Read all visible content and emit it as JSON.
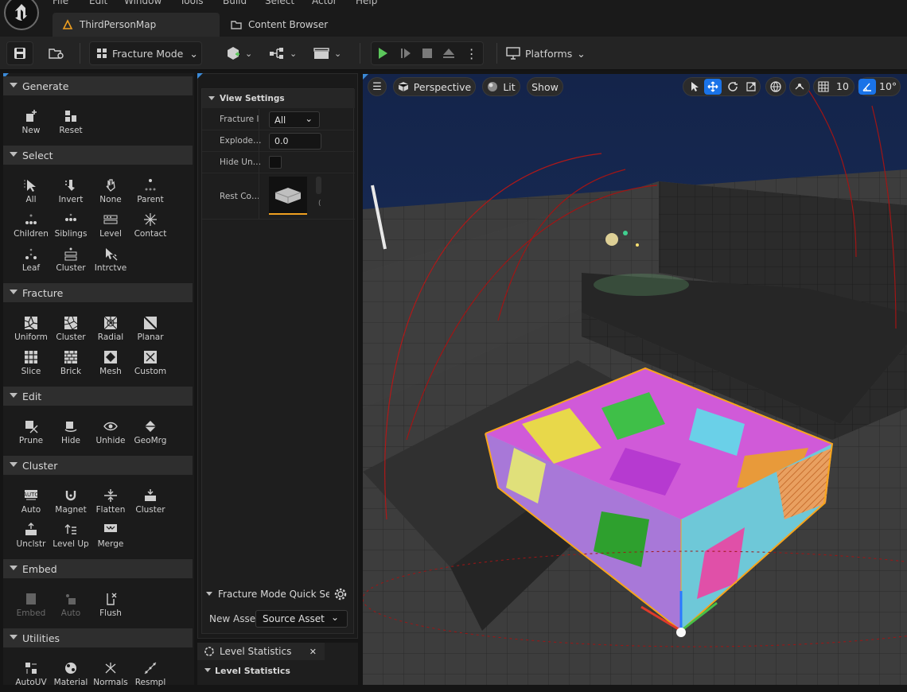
{
  "menu": [
    "File",
    "Edit",
    "Window",
    "Tools",
    "Build",
    "Select",
    "Actor",
    "Help"
  ],
  "tabs": {
    "map": "ThirdPersonMap",
    "content_browser": "Content Browser"
  },
  "toolbar": {
    "mode_label": "Fracture Mode",
    "platforms_label": "Platforms"
  },
  "sections": {
    "generate": {
      "title": "Generate",
      "tools": [
        "New",
        "Reset"
      ]
    },
    "select": {
      "title": "Select",
      "tools": [
        "All",
        "Invert",
        "None",
        "Parent",
        "Children",
        "Siblings",
        "Level",
        "Contact",
        "Leaf",
        "Cluster",
        "Intrctve"
      ]
    },
    "fracture": {
      "title": "Fracture",
      "tools": [
        "Uniform",
        "Cluster",
        "Radial",
        "Planar",
        "Slice",
        "Brick",
        "Mesh",
        "Custom"
      ]
    },
    "edit": {
      "title": "Edit",
      "tools": [
        "Prune",
        "Hide",
        "Unhide",
        "GeoMrg"
      ]
    },
    "cluster": {
      "title": "Cluster",
      "tools": [
        "Auto",
        "Magnet",
        "Flatten",
        "Cluster",
        "Unclstr",
        "Level Up",
        "Merge"
      ]
    },
    "embed": {
      "title": "Embed",
      "tools": [
        "Embed",
        "Auto",
        "Flush"
      ]
    },
    "utilities": {
      "title": "Utilities",
      "tools": [
        "AutoUV",
        "Material",
        "Normals",
        "Resmpl"
      ]
    }
  },
  "view_settings": {
    "title": "View Settings",
    "rows": [
      {
        "label": "Fracture l",
        "value": "All"
      },
      {
        "label": "Explode…",
        "value": "0.0"
      },
      {
        "label": "Hide Un…",
        "value": ""
      },
      {
        "label": "Rest Co…",
        "value": ""
      }
    ]
  },
  "quick_settings": {
    "title": "Fracture Mode Quick Se",
    "new_asset_label": "New Asse",
    "source_label": "Source Asset"
  },
  "level_stats": {
    "tab_label": "Level Statistics",
    "header": "Level Statistics"
  },
  "viewport": {
    "perspective": "Perspective",
    "lit": "Lit",
    "show": "Show",
    "grid_size": "10",
    "rot_snap": "10°"
  },
  "colors": {
    "accent_blue": "#1a73e8",
    "play_green": "#5cc75c",
    "selection_orange": "#f7a51c"
  }
}
